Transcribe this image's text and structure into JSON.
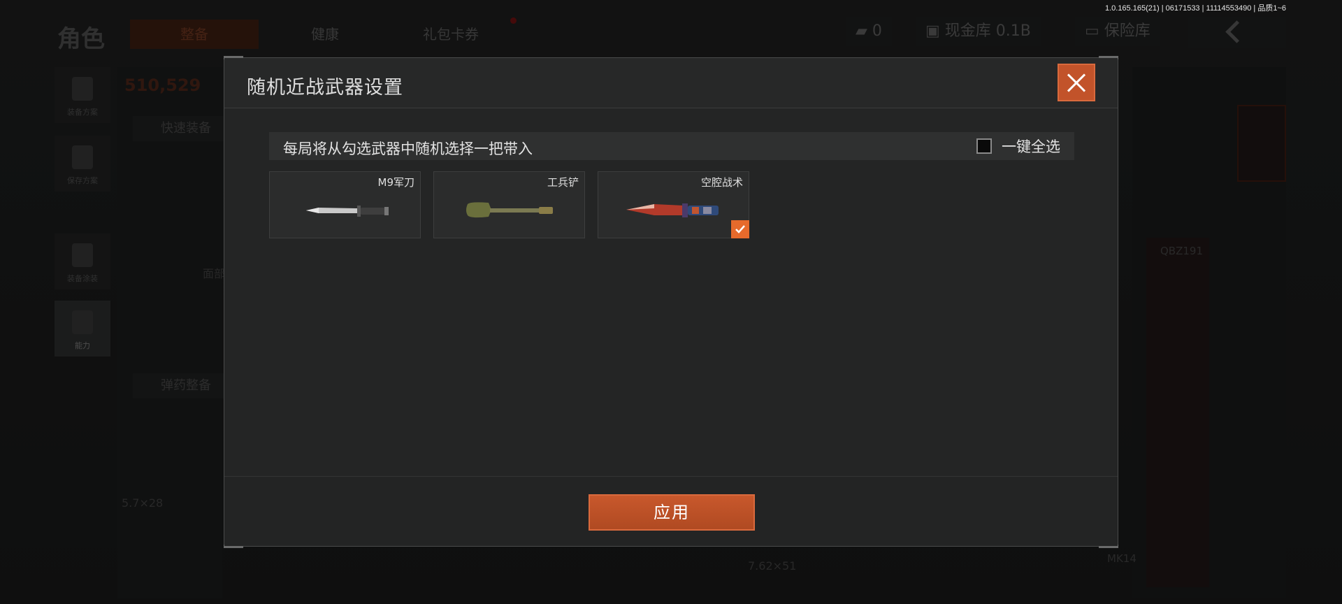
{
  "version_info": "1.0.165.165(21) | 06171533 | 11114553490 | 品质1~6",
  "background": {
    "page_title": "角色",
    "tabs": [
      "整备",
      "健康",
      "礼包卡券"
    ],
    "currency_count": "0",
    "cash_vault": "现金库 0.1B",
    "safe": "保险库",
    "side_items": [
      "装备方案",
      "保存方案",
      "装备涂装",
      "能力"
    ],
    "score": "510,529",
    "quick_equip": "快速装备",
    "ammo_equip": "弹药整备",
    "caliber_a": "5.7×28",
    "caliber_b": "7.62×51",
    "weapon_label_a": "QBZ191",
    "weapon_label_b": "MK14",
    "face_label": "面部"
  },
  "modal": {
    "title": "随机近战武器设置",
    "info_text": "每局将从勾选武器中随机选择一把带入",
    "select_all_label": "一键全选",
    "weapons": [
      {
        "name": "M9军刀",
        "checked": false
      },
      {
        "name": "工兵铲",
        "checked": false
      },
      {
        "name": "空腔战术",
        "checked": true
      }
    ],
    "apply_label": "应用",
    "accent_color": "#c2532a"
  }
}
